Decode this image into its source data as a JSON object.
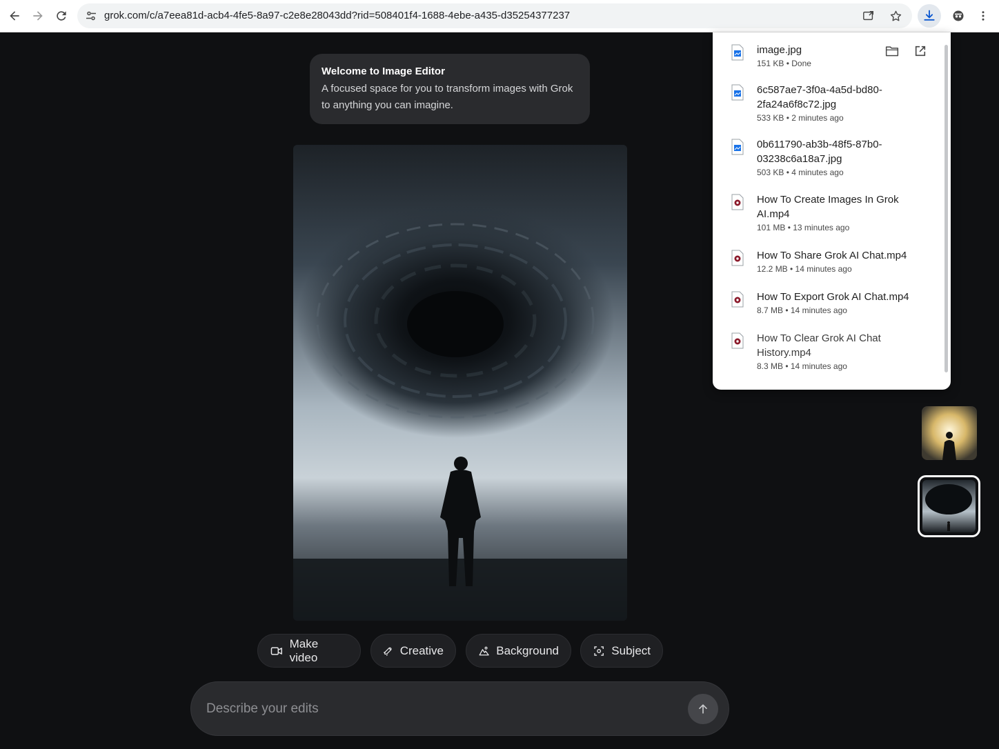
{
  "browser": {
    "url": "grok.com/c/a7eea81d-acb4-4fe5-8a97-c2e8e28043dd?rid=508401f4-1688-4ebe-a435-d35254377237"
  },
  "welcome": {
    "title": "Welcome to Image Editor",
    "description": "A focused space for you to transform images with Grok to anything you can imagine."
  },
  "actions": {
    "make_video": "Make video",
    "creative": "Creative",
    "background": "Background",
    "subject": "Subject"
  },
  "composer": {
    "placeholder": "Describe your edits"
  },
  "downloads": {
    "items": [
      {
        "name": "image.jpg",
        "meta": "151 KB • Done",
        "type": "image"
      },
      {
        "name": "6c587ae7-3f0a-4a5d-bd80-2fa24a6f8c72.jpg",
        "meta": "533 KB • 2 minutes ago",
        "type": "image"
      },
      {
        "name": "0b611790-ab3b-48f5-87b0-03238c6a18a7.jpg",
        "meta": "503 KB • 4 minutes ago",
        "type": "image"
      },
      {
        "name": "How To Create Images In Grok AI.mp4",
        "meta": "101 MB • 13 minutes ago",
        "type": "video"
      },
      {
        "name": "How To Share Grok AI Chat.mp4",
        "meta": "12.2 MB • 14 minutes ago",
        "type": "video"
      },
      {
        "name": "How To Export Grok AI Chat.mp4",
        "meta": "8.7 MB • 14 minutes ago",
        "type": "video"
      },
      {
        "name": "How To Clear Grok AI Chat History.mp4",
        "meta": "8.3 MB • 14 minutes ago",
        "type": "video"
      }
    ]
  },
  "colors": {
    "background": "#0f1012",
    "card": "#2a2b2e",
    "chip": "#1f2023"
  }
}
